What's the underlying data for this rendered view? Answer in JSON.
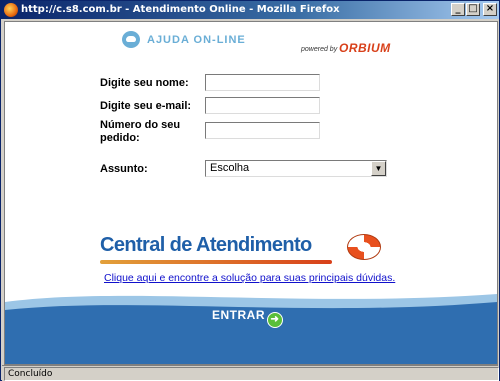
{
  "window": {
    "title": "http://c.s8.com.br - Atendimento Online - Mozilla Firefox",
    "minimize": "_",
    "maximize": "□",
    "close": "×"
  },
  "header": {
    "ajuda": "AJUDA ON-LINE",
    "powered_by": "powered by",
    "brand": "ORBIUM"
  },
  "form": {
    "name_label": "Digite seu nome:",
    "name_value": "",
    "email_label": "Digite seu e-mail:",
    "email_value": "",
    "order_label_line1": "Número do seu",
    "order_label_line2": "pedido:",
    "order_value": "",
    "subject_label": "Assunto:",
    "subject_value": "Escolha"
  },
  "central": {
    "title": "Central de Atendimento",
    "link": "Clique aqui e encontre a solução para suas principais dúvidas.",
    "enter_button": "ENTRAR"
  },
  "statusbar": {
    "text": "Concluído"
  }
}
